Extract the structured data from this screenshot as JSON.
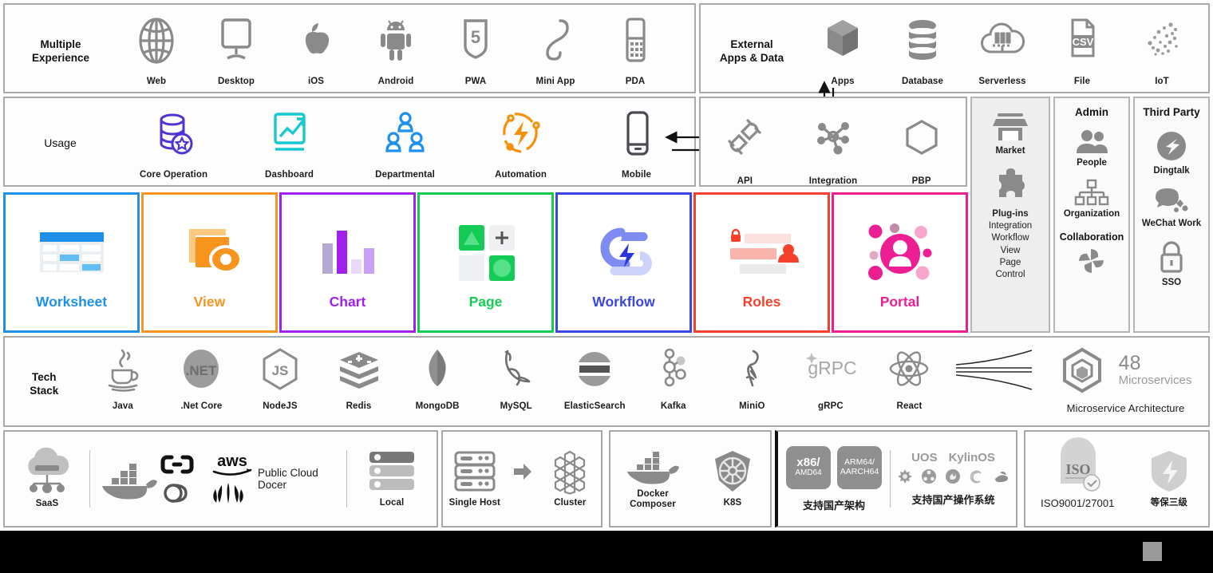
{
  "rows": {
    "multiple_experience": {
      "label": "Multiple\nExperience",
      "items": [
        {
          "name": "Web",
          "icon": "globe-icon"
        },
        {
          "name": "Desktop",
          "icon": "desktop-monitor-icon"
        },
        {
          "name": "iOS",
          "icon": "apple-icon"
        },
        {
          "name": "Android",
          "icon": "android-icon"
        },
        {
          "name": "PWA",
          "icon": "html5-shield-icon"
        },
        {
          "name": "Mini App",
          "icon": "miniapp-icon"
        },
        {
          "name": "PDA",
          "icon": "pda-device-icon"
        }
      ]
    },
    "external_apps_data": {
      "label": "External\nApps & Data",
      "items": [
        {
          "name": "Apps",
          "icon": "cube-box-icon"
        },
        {
          "name": "Database",
          "icon": "database-cylinder-icon"
        },
        {
          "name": "Serverless",
          "icon": "serverless-cloud-icon"
        },
        {
          "name": "File",
          "icon": "csv-file-icon"
        },
        {
          "name": "IoT",
          "icon": "iot-dots-icon"
        }
      ]
    },
    "usage": {
      "label": "Usage",
      "items": [
        {
          "name": "Core Operation",
          "icon": "database-star-icon",
          "color": "#4b35d4"
        },
        {
          "name": "Dashboard",
          "icon": "chart-trend-icon",
          "color": "#17c8d4"
        },
        {
          "name": "Departmental",
          "icon": "people-group-icon",
          "color": "#1e90f0"
        },
        {
          "name": "Automation",
          "icon": "automation-bolt-icon",
          "color": "#f79009"
        },
        {
          "name": "Mobile",
          "icon": "mobile-phone-icon",
          "color": "#4a4a52"
        }
      ]
    },
    "platform_interfaces": {
      "items": [
        {
          "name": "API",
          "icon": "plug-connector-icon"
        },
        {
          "name": "Integration",
          "icon": "integration-node-icon"
        },
        {
          "name": "PBP",
          "icon": "hexagon-icon"
        }
      ]
    },
    "tech_stack": {
      "label": "Tech\nStack",
      "items": [
        {
          "name": "Java",
          "icon": "java-coffee-icon"
        },
        {
          "name": ".Net Core",
          "icon": "dotnet-icon"
        },
        {
          "name": "NodeJS",
          "icon": "nodejs-hexagon-icon"
        },
        {
          "name": "Redis",
          "icon": "redis-stack-icon"
        },
        {
          "name": "MongoDB",
          "icon": "mongodb-leaf-icon"
        },
        {
          "name": "MySQL",
          "icon": "mysql-dolphin-icon"
        },
        {
          "name": "ElasticSearch",
          "icon": "elasticsearch-icon"
        },
        {
          "name": "Kafka",
          "icon": "kafka-nodes-icon"
        },
        {
          "name": "MiniO",
          "icon": "minio-flamingo-icon"
        },
        {
          "name": "gRPC",
          "icon": "grpc-wordmark-icon"
        },
        {
          "name": "React",
          "icon": "react-atom-icon"
        }
      ],
      "microservices": {
        "count": "48",
        "unit": "Microservices",
        "caption": "Microservice Architecture",
        "icon": "hexagon-cube-icon"
      }
    }
  },
  "side_panels": {
    "market": {
      "items": [
        {
          "name": "Market",
          "icon": "storefront-icon"
        }
      ],
      "plugins": {
        "title": "Plug-ins",
        "list": [
          "Integration",
          "Workflow",
          "View",
          "Page",
          "Control"
        ],
        "icon": "puzzle-piece-icon"
      }
    },
    "admin": {
      "title": "Admin",
      "items": [
        {
          "name": "People",
          "icon": "people-pair-icon"
        },
        {
          "name": "Organization",
          "icon": "org-chart-icon"
        }
      ],
      "collaboration": {
        "title": "Collaboration",
        "icon": "pinwheel-icon"
      }
    },
    "third_party": {
      "title": "Third Party",
      "items": [
        {
          "name": "Dingtalk",
          "icon": "dingtalk-icon"
        },
        {
          "name": "WeChat Work",
          "icon": "wechat-work-icon"
        },
        {
          "name": "SSO",
          "icon": "lock-icon"
        }
      ]
    }
  },
  "modules": [
    {
      "name": "Worksheet",
      "color": "#1e90e8",
      "icon": "worksheet-table-icon"
    },
    {
      "name": "View",
      "color": "#f7941e",
      "icon": "view-layers-eye-icon"
    },
    {
      "name": "Chart",
      "color": "#a020f0",
      "icon": "bar-chart-icon"
    },
    {
      "name": "Page",
      "color": "#14cc55",
      "icon": "page-tiles-icon"
    },
    {
      "name": "Workflow",
      "color": "#3b46e0",
      "icon": "workflow-bolt-icon"
    },
    {
      "name": "Roles",
      "color": "#f5402c",
      "icon": "roles-permission-icon"
    },
    {
      "name": "Portal",
      "color": "#ed1e94",
      "icon": "portal-user-icon"
    }
  ],
  "deployment": {
    "saas": {
      "name": "SaaS",
      "icon": "cloud-network-icon"
    },
    "public_cloud": {
      "label": "Public Cloud Docer",
      "icons": [
        "docker-whale-icon",
        "alibaba-cloud-icon",
        "aws-icon",
        "tencent-cloud-icon",
        "huawei-cloud-icon"
      ]
    },
    "local": {
      "name": "Local",
      "icon": "server-rack-icon"
    },
    "hosting": [
      {
        "name": "Single Host",
        "icon": "server-stack-icon"
      },
      {
        "name": "Cluster",
        "icon": "cluster-hex-icon"
      }
    ],
    "containers": [
      {
        "name": "Docker\nComposer",
        "icon": "docker-whale-icon"
      },
      {
        "name": "K8S",
        "icon": "kubernetes-helm-icon"
      }
    ],
    "domestic": {
      "arch_caption": "支持国产架构",
      "os_caption": "支持国产操作系统",
      "arch_badges": [
        {
          "top": "x86/",
          "bottom": "AMD64"
        },
        {
          "top": "ARM64/",
          "bottom": "AARCH64"
        }
      ],
      "os_names": [
        "UOS",
        "KylinOS"
      ],
      "os_icons": [
        "kylin-icon",
        "ubuntu-icon",
        "deepin-icon",
        "debian-icon",
        "redhat-icon"
      ]
    },
    "certifications": [
      {
        "name": "ISO9001/27001",
        "icon": "iso-badge-icon"
      },
      {
        "name": "等保三级",
        "icon": "shield-bolt-icon"
      }
    ]
  }
}
